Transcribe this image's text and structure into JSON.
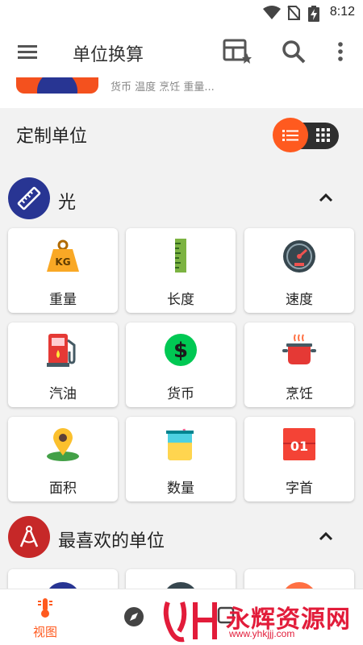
{
  "status_bar": {
    "time": "8:12",
    "icons": [
      "wifi-icon",
      "no-sim-icon",
      "battery-charging-icon"
    ]
  },
  "app_bar": {
    "title": "单位换算",
    "icons": [
      "menu-icon",
      "favorite-units-icon",
      "search-icon",
      "more-vert-icon"
    ]
  },
  "promo": {
    "subtitle": "货币 温度 烹饪 重量..."
  },
  "custom": {
    "label": "定制单位",
    "view_mode": "list"
  },
  "sections": [
    {
      "name": "光",
      "icon": "ruler-icon",
      "color": "#283593",
      "expanded": true,
      "items": [
        {
          "label": "重量",
          "icon": "weight-kg-icon"
        },
        {
          "label": "长度",
          "icon": "ruler-green-icon"
        },
        {
          "label": "速度",
          "icon": "speedometer-icon"
        },
        {
          "label": "汽油",
          "icon": "fuel-pump-icon"
        },
        {
          "label": "货币",
          "icon": "dollar-icon"
        },
        {
          "label": "烹饪",
          "icon": "cooking-pot-icon"
        },
        {
          "label": "面积",
          "icon": "map-pin-icon"
        },
        {
          "label": "数量",
          "icon": "beaker-icon"
        },
        {
          "label": "字首",
          "icon": "prefix-01-icon"
        }
      ]
    },
    {
      "name": "最喜欢的单位",
      "icon": "compass-drafting-icon",
      "color": "#c62828",
      "expanded": true
    }
  ],
  "bottom_nav": {
    "items": [
      {
        "label": "视图",
        "icon": "thermometer-icon",
        "active": true
      },
      {
        "label": "",
        "icon": "compass-icon",
        "active": false
      }
    ],
    "watermark": {
      "brand": "永辉资源网",
      "url": "www.yhkjjj.com"
    }
  },
  "colors": {
    "accent": "#ff5a1f",
    "section1": "#283593",
    "section2": "#c62828"
  }
}
